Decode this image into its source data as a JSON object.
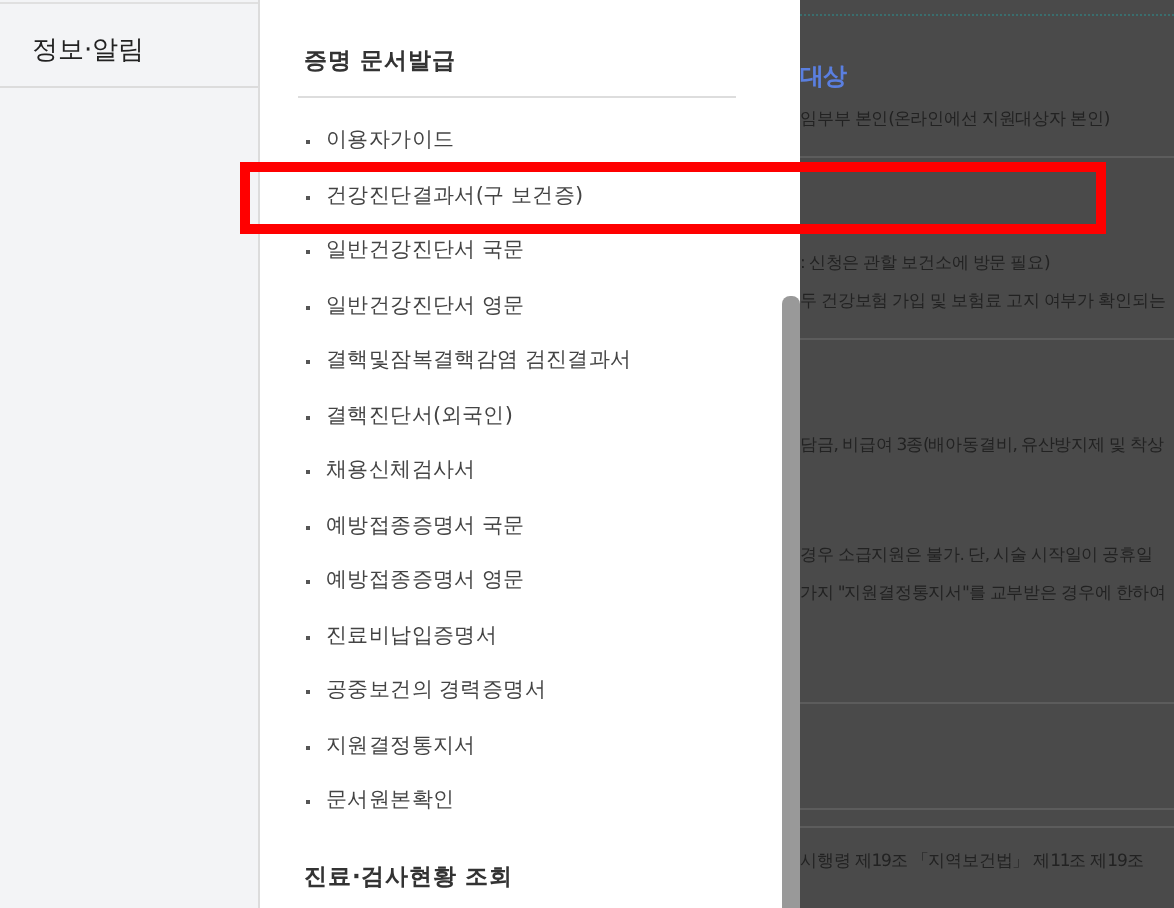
{
  "sidebar": {
    "items": [
      {
        "label": "정보·알림"
      }
    ]
  },
  "menu": {
    "sections": [
      {
        "heading": "증명 문서발급",
        "items": [
          {
            "label": "이용자가이드",
            "highlighted": false
          },
          {
            "label": "건강진단결과서(구 보건증)",
            "highlighted": true
          },
          {
            "label": "일반건강진단서 국문",
            "highlighted": false
          },
          {
            "label": "일반건강진단서 영문",
            "highlighted": false
          },
          {
            "label": "결핵및잠복결핵감염 검진결과서",
            "highlighted": false
          },
          {
            "label": "결핵진단서(외국인)",
            "highlighted": false
          },
          {
            "label": "채용신체검사서",
            "highlighted": false
          },
          {
            "label": "예방접종증명서 국문",
            "highlighted": false
          },
          {
            "label": "예방접종증명서 영문",
            "highlighted": false
          },
          {
            "label": "진료비납입증명서",
            "highlighted": false
          },
          {
            "label": "공중보건의 경력증명서",
            "highlighted": false
          },
          {
            "label": "지원결정통지서",
            "highlighted": false
          },
          {
            "label": "문서원본확인",
            "highlighted": false
          }
        ]
      },
      {
        "heading": "진료·검사현황 조회"
      }
    ]
  },
  "background": {
    "lines": [
      {
        "kind": "heading",
        "text": "대상"
      },
      {
        "kind": "text",
        "text": "임부부 본인(온라인에선 지원대상자 본인)"
      },
      {
        "kind": "divider"
      },
      {
        "kind": "gap"
      },
      {
        "kind": "text",
        "text": ": 신청은 관할 보건소에 방문 필요)"
      },
      {
        "kind": "text",
        "text": "두 건강보험 가입 및 보험료 고지 여부가 확인되는"
      },
      {
        "kind": "divider"
      },
      {
        "kind": "gap"
      },
      {
        "kind": "text",
        "text": "담금, 비급여 3종(배아동결비, 유산방지제 및 착상"
      },
      {
        "kind": "gap"
      },
      {
        "kind": "text",
        "text": "경우 소급지원은 불가. 단, 시술 시작일이 공휴일"
      },
      {
        "kind": "text",
        "text": "가지 \"지원결정통지서\"를 교부받은 경우에 한하여"
      },
      {
        "kind": "gap"
      },
      {
        "kind": "divider"
      },
      {
        "kind": "gap"
      },
      {
        "kind": "divider"
      },
      {
        "kind": "divider"
      },
      {
        "kind": "text",
        "text": "시행령 제19조 「지역보건법」 제11조 제19조"
      }
    ]
  }
}
